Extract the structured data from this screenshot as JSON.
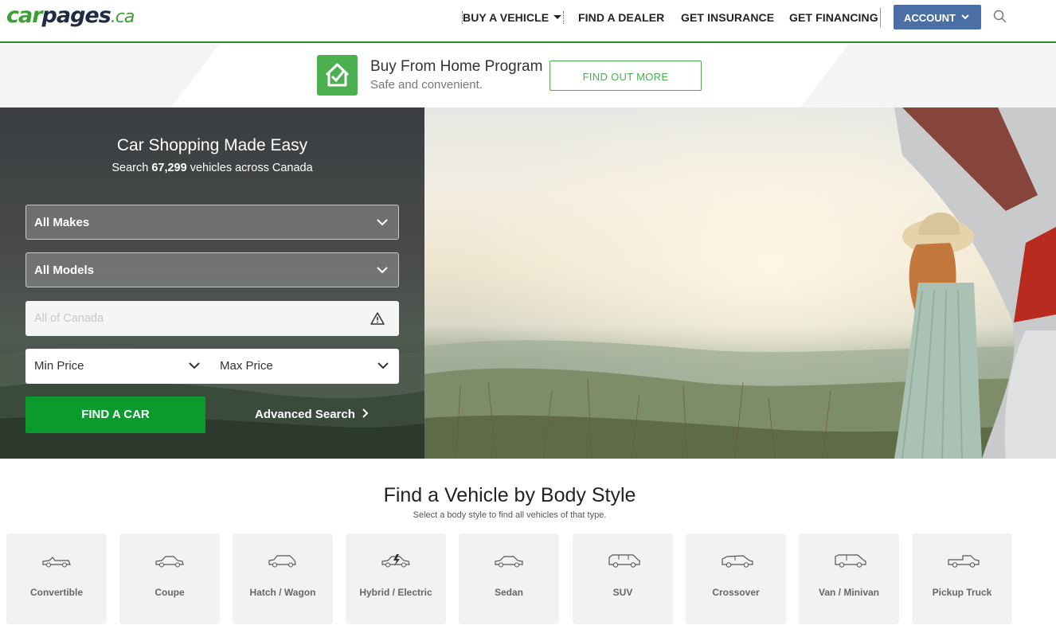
{
  "header": {
    "logo": {
      "car": "car",
      "pages": "pages",
      "ca": ".ca"
    },
    "nav": {
      "buy_vehicle": "BUY A VEHICLE",
      "find_dealer": "FIND A DEALER",
      "get_insurance": "GET INSURANCE",
      "get_financing": "GET FINANCING"
    },
    "account_label": "ACCOUNT",
    "search_icon": "search-icon"
  },
  "promo": {
    "icon": "house-check-icon",
    "title": "Buy From Home Program",
    "subtitle": "Safe and convenient.",
    "button": "FIND OUT MORE"
  },
  "hero": {
    "title": "Car Shopping Made Easy",
    "sub_prefix": "Search ",
    "vehicle_count": "67,299",
    "sub_suffix": " vehicles across Canada",
    "makes_select": "All Makes",
    "models_select": "All Models",
    "location_placeholder": "All of Canada",
    "location_icon": "warning-icon",
    "min_price": "Min Price",
    "max_price": "Max Price",
    "find_button": "FIND A CAR",
    "advanced_search": "Advanced Search"
  },
  "body_styles": {
    "title": "Find a Vehicle by Body Style",
    "subtitle": "Select a body style to find all vehicles of that type.",
    "items": [
      {
        "label": "Convertible",
        "icon": "convertible-icon"
      },
      {
        "label": "Coupe",
        "icon": "coupe-icon"
      },
      {
        "label": "Hatch / Wagon",
        "icon": "hatchback-icon"
      },
      {
        "label": "Hybrid / Electric",
        "icon": "hybrid-electric-icon"
      },
      {
        "label": "Sedan",
        "icon": "sedan-icon"
      },
      {
        "label": "SUV",
        "icon": "suv-icon"
      },
      {
        "label": "Crossover",
        "icon": "crossover-icon"
      },
      {
        "label": "Van / Minivan",
        "icon": "van-icon"
      },
      {
        "label": "Pickup Truck",
        "icon": "pickup-truck-icon"
      }
    ]
  },
  "colors": {
    "brand_green": "#3aa034",
    "find_button": "#0a9b2c",
    "account_button": "#4a6fa5",
    "promo_accent": "#4caf50"
  }
}
